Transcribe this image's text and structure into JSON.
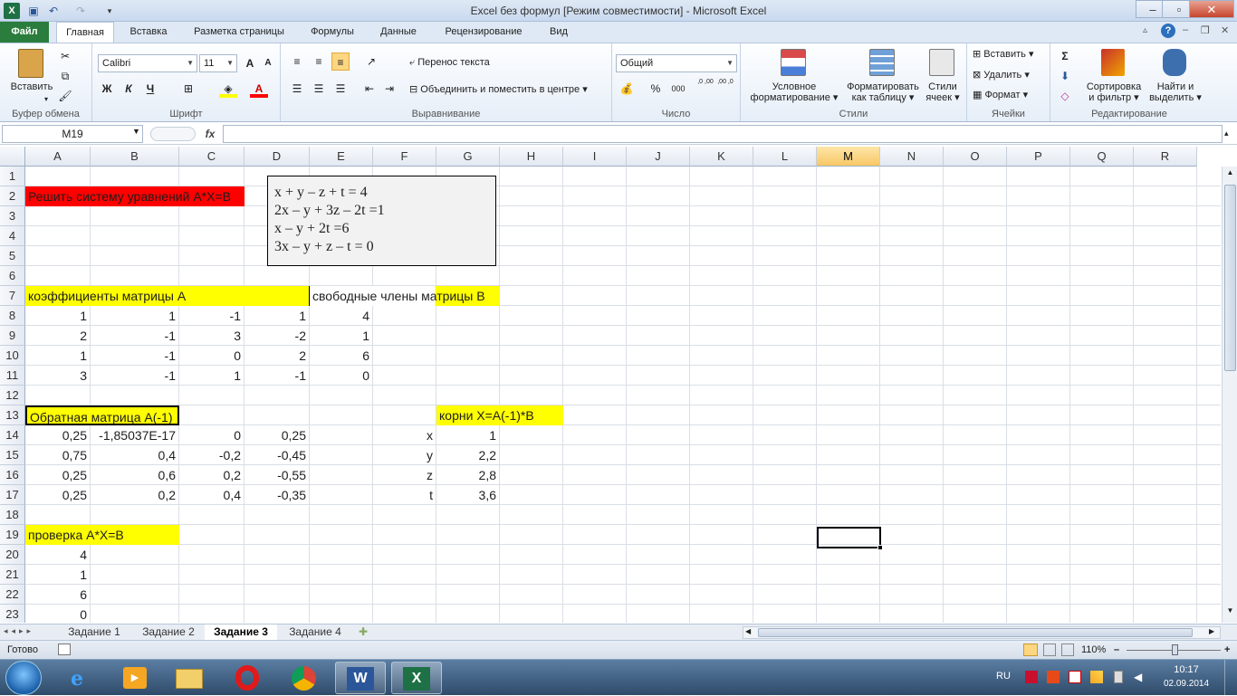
{
  "window": {
    "title": "Excel без формул  [Режим совместимости]  -  Microsoft Excel"
  },
  "quick_access": {
    "app_icon": "excel-app-icon",
    "save_icon": "save-icon",
    "undo_icon": "undo-icon",
    "redo_icon": "redo-icon",
    "customize_icon": "customize-icon"
  },
  "window_controls": {
    "minimize": "–",
    "maximize": "▫",
    "close": "✕"
  },
  "tabs": [
    "Файл",
    "Главная",
    "Вставка",
    "Разметка страницы",
    "Формулы",
    "Данные",
    "Рецензирование",
    "Вид"
  ],
  "tabs_active": "Главная",
  "ribbon": {
    "clipboard": {
      "label": "Буфер обмена",
      "paste": "Вставить"
    },
    "font": {
      "label": "Шрифт",
      "name": "Calibri",
      "size": "11",
      "bold": "Ж",
      "italic": "К",
      "underline": "Ч",
      "grow": "A",
      "shrink": "A"
    },
    "alignment": {
      "label": "Выравнивание",
      "wrap": "Перенос текста",
      "merge": "Объединить и поместить в центре"
    },
    "number": {
      "label": "Число",
      "format": "Общий",
      "percent": "%",
      "thousands": "000",
      "inc_dec": ",0 ,00",
      "dec_dec": ",00 ,0"
    },
    "styles": {
      "label": "Стили",
      "conditional": [
        "Условное",
        "форматирование"
      ],
      "as_table": [
        "Форматировать",
        "как таблицу"
      ],
      "cell_styles": [
        "Стили",
        "ячеек"
      ]
    },
    "cells": {
      "label": "Ячейки",
      "insert": "Вставить",
      "delete": "Удалить",
      "format": "Формат"
    },
    "editing": {
      "label": "Редактирование",
      "sort": [
        "Сортировка",
        "и фильтр"
      ],
      "find": [
        "Найти и",
        "выделить"
      ],
      "sigma": "Σ"
    }
  },
  "formula_bar": {
    "namebox": "M19",
    "fx": "fx",
    "value": ""
  },
  "columns": [
    "A",
    "B",
    "C",
    "D",
    "E",
    "F",
    "G",
    "H",
    "I",
    "J",
    "K",
    "L",
    "M",
    "N",
    "O",
    "P",
    "Q",
    "R"
  ],
  "selected_column": "M",
  "rows": [
    "1",
    "2",
    "3",
    "4",
    "5",
    "6",
    "7",
    "8",
    "9",
    "10",
    "11",
    "12",
    "13",
    "14",
    "15",
    "16",
    "17",
    "18",
    "19",
    "20",
    "21",
    "22",
    "23"
  ],
  "cells": {
    "A2": "Решить систему уравнений А*Х=В",
    "A7": "  коэффициенты матрицы А",
    "E7": "свободные члены матрицы В",
    "matrixA": [
      [
        "1",
        "1",
        "-1",
        "1"
      ],
      [
        "2",
        "-1",
        "3",
        "-2"
      ],
      [
        "1",
        "-1",
        "0",
        "2"
      ],
      [
        "3",
        "-1",
        "1",
        "-1"
      ]
    ],
    "vectorB": [
      "4",
      "1",
      "6",
      "0"
    ],
    "A13": "Обратная матрица А(-1)",
    "G13": "корни Х=А(-1)*В",
    "inverse": [
      [
        "0,25",
        "-1,85037E-17",
        "0",
        "0,25"
      ],
      [
        "0,75",
        "0,4",
        "-0,2",
        "-0,45"
      ],
      [
        "0,25",
        "0,6",
        "0,2",
        "-0,55"
      ],
      [
        "0,25",
        "0,2",
        "0,4",
        "-0,35"
      ]
    ],
    "root_names": [
      "x",
      "y",
      "z",
      "t"
    ],
    "roots": [
      "1",
      "2,2",
      "2,8",
      "3,6"
    ],
    "A19": "проверка А*Х=В",
    "check": [
      "4",
      "1",
      "6",
      "0"
    ]
  },
  "textbox": [
    "x + y – z + t = 4",
    "2x – y + 3z – 2t =1",
    "x – y + 2t =6",
    "3x – y + z – t = 0"
  ],
  "sheets": [
    "Задание 1",
    "Задание 2",
    "Задание 3",
    "Задание 4"
  ],
  "active_sheet": "Задание 3",
  "status": {
    "ready": "Готово",
    "zoom": "110%",
    "zoom_minus": "–",
    "zoom_plus": "+"
  },
  "taskbar": {
    "lang": "RU",
    "time": "10:17",
    "date": "02.09.2014"
  },
  "colors": {
    "yellow": "#ffff00",
    "red": "#ff0000",
    "selected_header": "#f8c765",
    "file_tab": "#2a7d3c"
  }
}
